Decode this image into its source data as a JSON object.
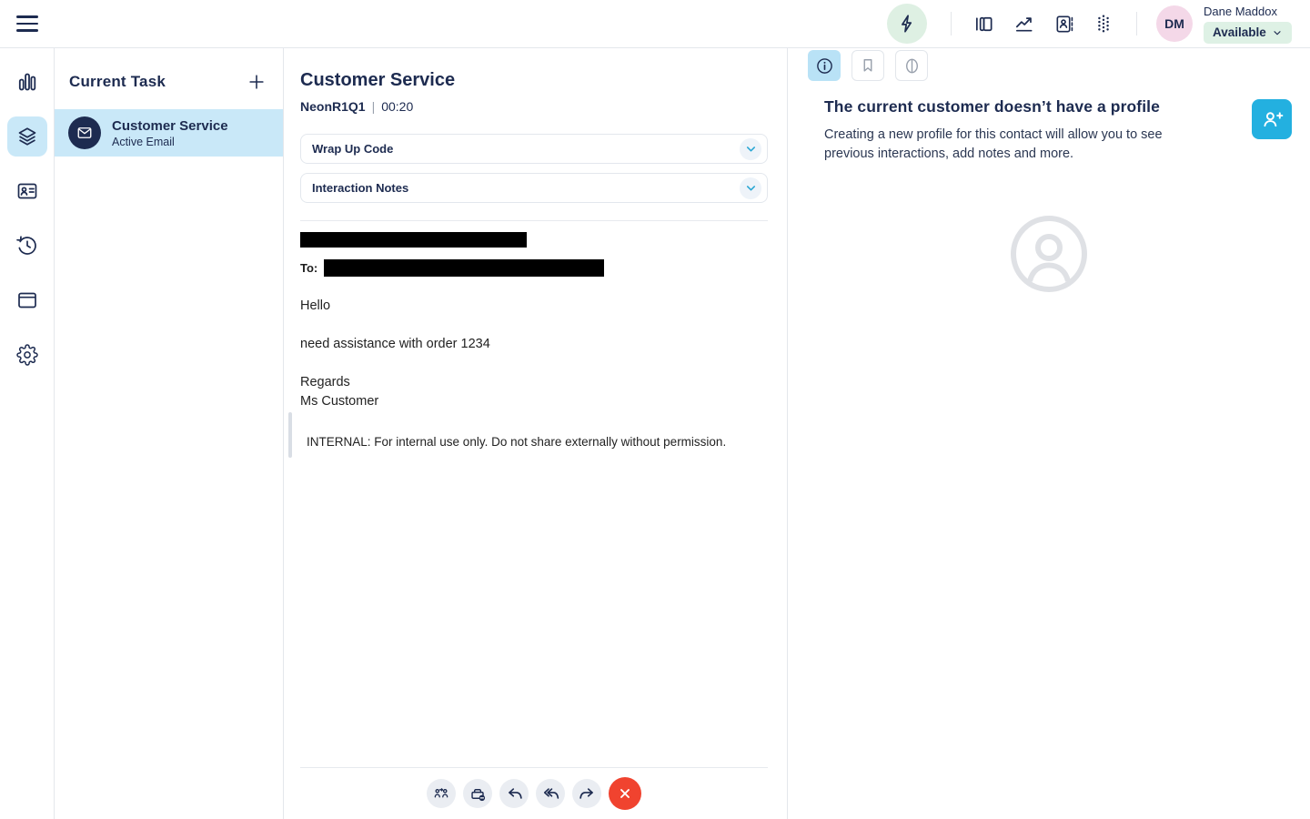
{
  "topbar": {
    "icons": [
      "hamburger-menu",
      "quick-actions-lightning",
      "panels",
      "performance-chart",
      "contacts-book",
      "dialpad"
    ],
    "user": {
      "initials": "DM",
      "name": "Dane Maddox",
      "status": "Available"
    }
  },
  "nav_rail": {
    "items": [
      "analytics",
      "interactions",
      "contacts",
      "history",
      "apps-window",
      "settings"
    ],
    "active": "interactions"
  },
  "task_panel": {
    "title": "Current Task",
    "tasks": [
      {
        "title": "Customer Service",
        "subtitle": "Active Email",
        "type": "email"
      }
    ]
  },
  "interaction": {
    "title": "Customer Service",
    "queue": "NeonR1Q1",
    "separator": "|",
    "timer": "00:20",
    "accordions": [
      {
        "label": "Wrap Up Code"
      },
      {
        "label": "Interaction Notes"
      }
    ],
    "email": {
      "to_label": "To:",
      "greeting": "Hello",
      "body": "need assistance with order 1234",
      "signoff": "Regards",
      "signature": "Ms Customer",
      "internal_note": "INTERNAL: For internal use only. Do not share externally without permission."
    },
    "toolbar": [
      "transfer",
      "park-email",
      "reply",
      "reply-all",
      "forward",
      "disconnect"
    ]
  },
  "profile_panel": {
    "tabs": [
      "info",
      "bookmark",
      "copilot"
    ],
    "active_tab": "info",
    "heading": "The current customer doesn’t have a profile",
    "description": "Creating a new profile for this contact will allow you to see previous interactions, add notes and more."
  },
  "colors": {
    "navy": "#1d2b50",
    "accent_cyan": "#23b0e0",
    "chevron_cyan": "#2aa7d4",
    "highlight_blue": "#c9e8f8",
    "tab_active_blue": "#b9e2f6",
    "mint_green": "#def0e3",
    "status_green": "#def1e5",
    "avatar_pink": "#f4d8e8",
    "danger_red": "#f0432f",
    "toolbar_gray": "#eaedf2",
    "border_gray": "#e4e7ec",
    "placeholder_gray": "#dfe1e5"
  }
}
